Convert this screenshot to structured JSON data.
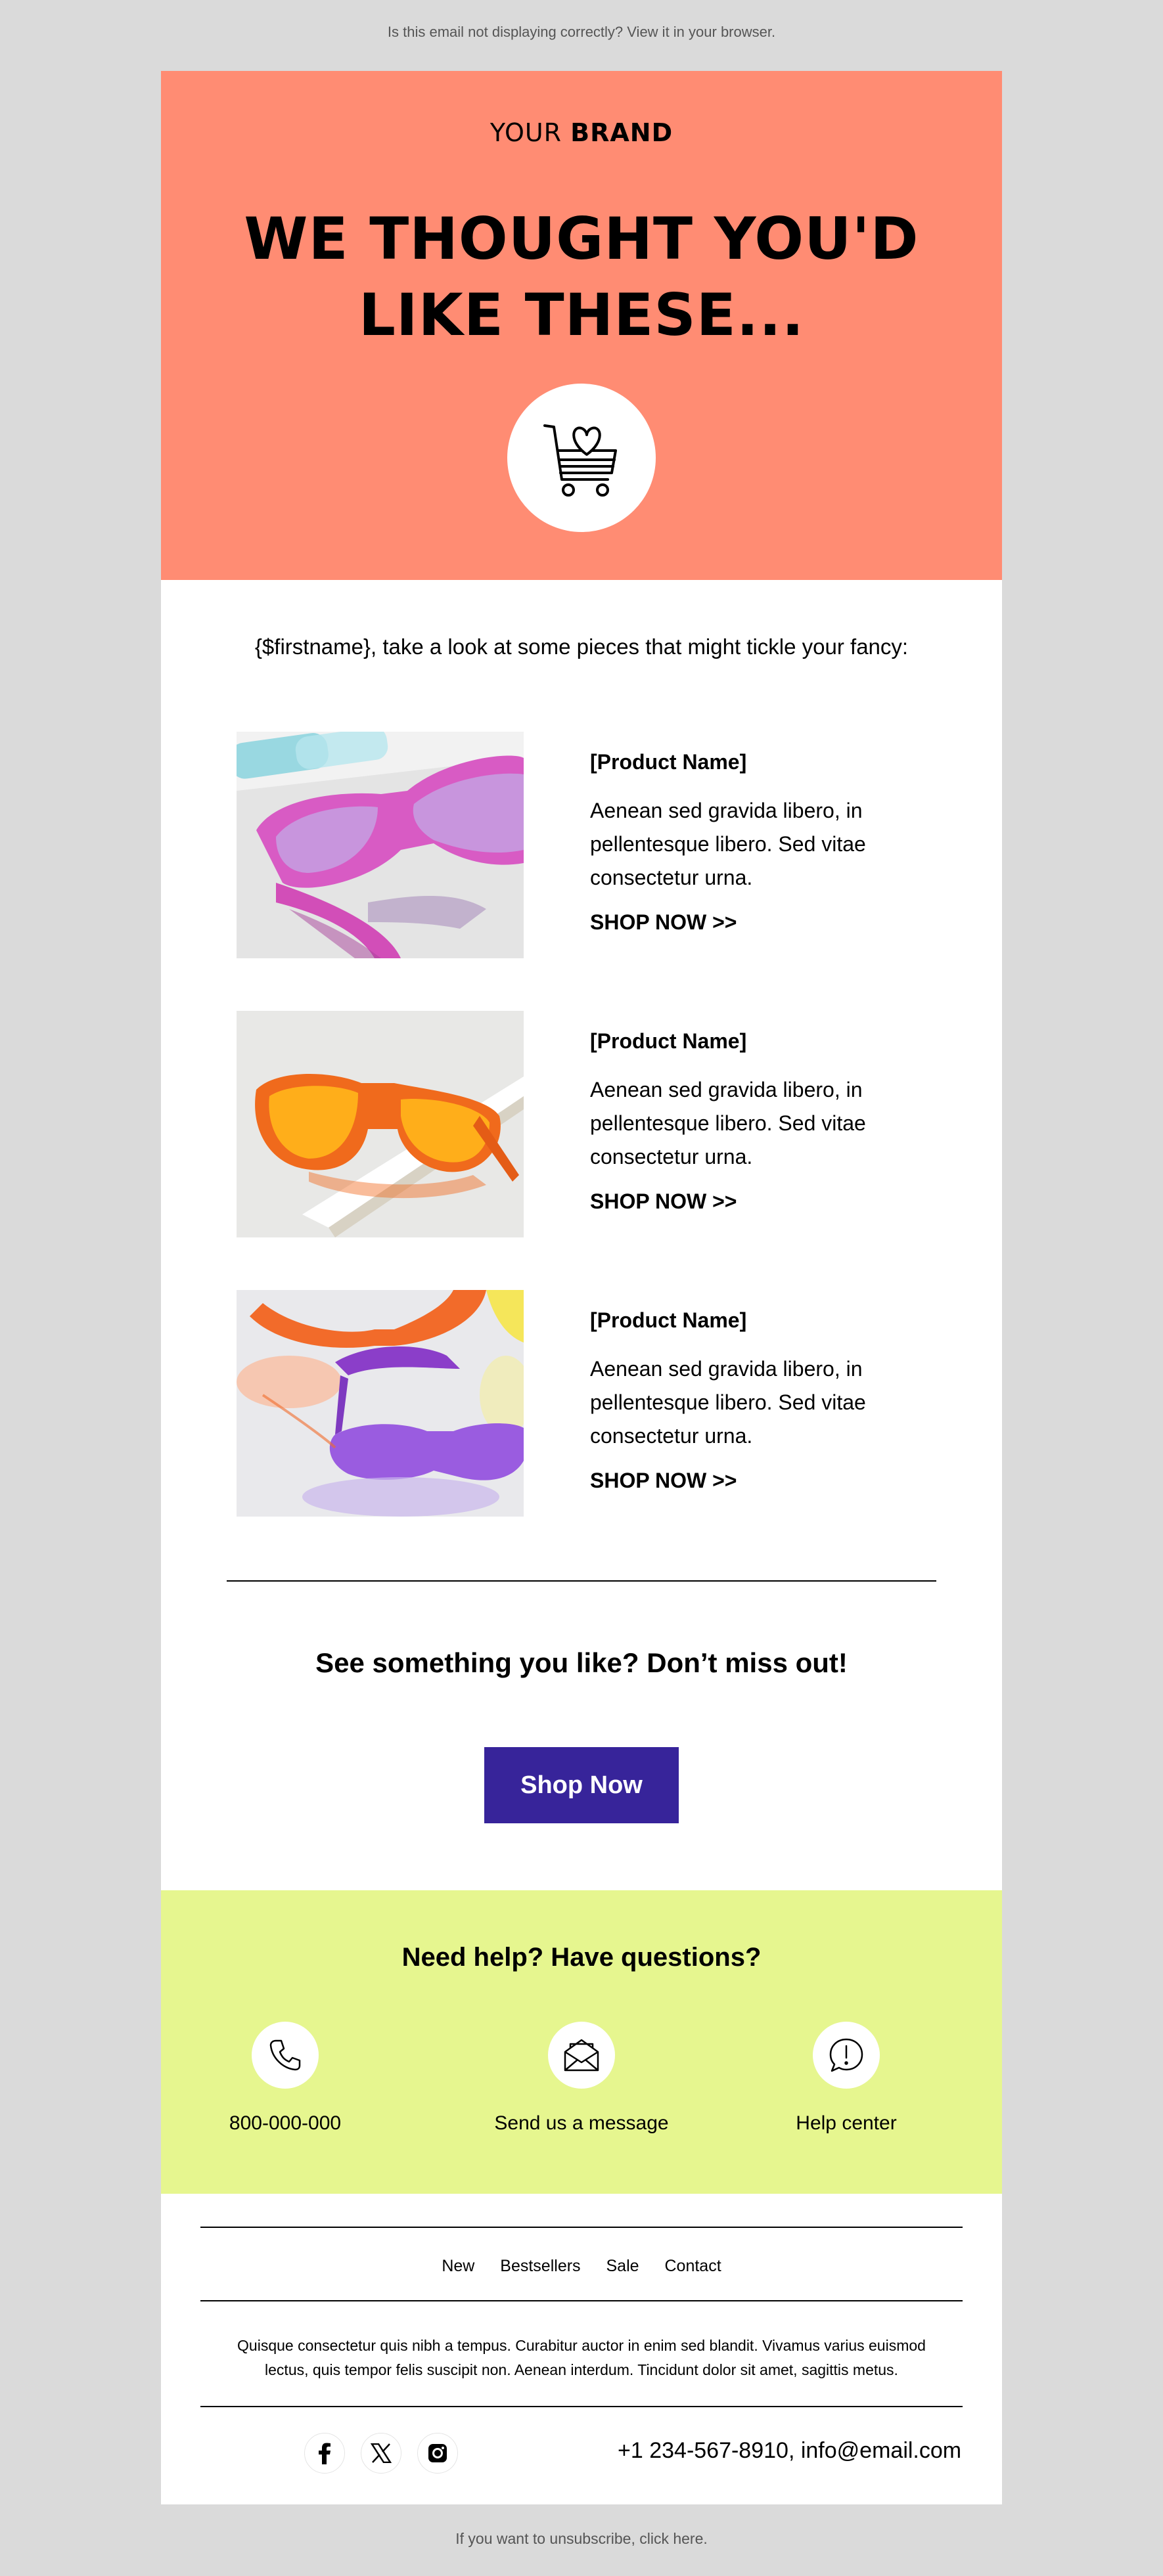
{
  "preheader": "Is this email not displaying correctly? View it in your browser.",
  "hero": {
    "logo_light": "YOUR ",
    "logo_bold": "BRAND",
    "headline_line1": "WE THOUGHT YOU'D",
    "headline_line2": "LIKE THESE...",
    "background_color": "#ff8c73",
    "icon": "cart-heart-icon"
  },
  "intro": "{$firstname}, take a look at some pieces that might tickle your fancy:",
  "products": [
    {
      "name": "[Product Name]",
      "description": "Aenean sed gravida libero, in pellentesque libero. Sed vitae consectetur urna.",
      "link": "SHOP NOW >>"
    },
    {
      "name": "[Product Name]",
      "description": "Aenean sed gravida libero, in pellentesque libero. Sed vitae consectetur urna.",
      "link": "SHOP NOW >>"
    },
    {
      "name": "[Product Name]",
      "description": "Aenean sed gravida libero, in pellentesque libero. Sed vitae consectetur urna.",
      "link": "SHOP NOW >>"
    }
  ],
  "cta": {
    "text": "See something you like? Don’t miss out!",
    "button": "Shop Now",
    "button_color": "#37249a"
  },
  "help": {
    "title": "Need help? Have questions?",
    "background_color": "#e6f68f",
    "items": [
      {
        "icon": "phone-icon",
        "label": "800-000-000"
      },
      {
        "icon": "envelope-icon",
        "label": "Send us a message"
      },
      {
        "icon": "help-center-icon",
        "label": "Help center"
      }
    ]
  },
  "footer": {
    "nav": [
      "New",
      "Bestsellers",
      "Sale",
      "Contact"
    ],
    "text": "Quisque consectetur quis nibh a tempus. Curabitur auctor in enim sed blandit. Vivamus varius euismod lectus, quis tempor felis suscipit non. Aenean interdum. Tincidunt dolor sit amet, sagittis metus.",
    "social": [
      "facebook-icon",
      "x-icon",
      "instagram-icon"
    ],
    "contact": "+1 234-567-8910, info@email.com"
  },
  "unsubscribe": "If you want to unsubscribe, click here."
}
